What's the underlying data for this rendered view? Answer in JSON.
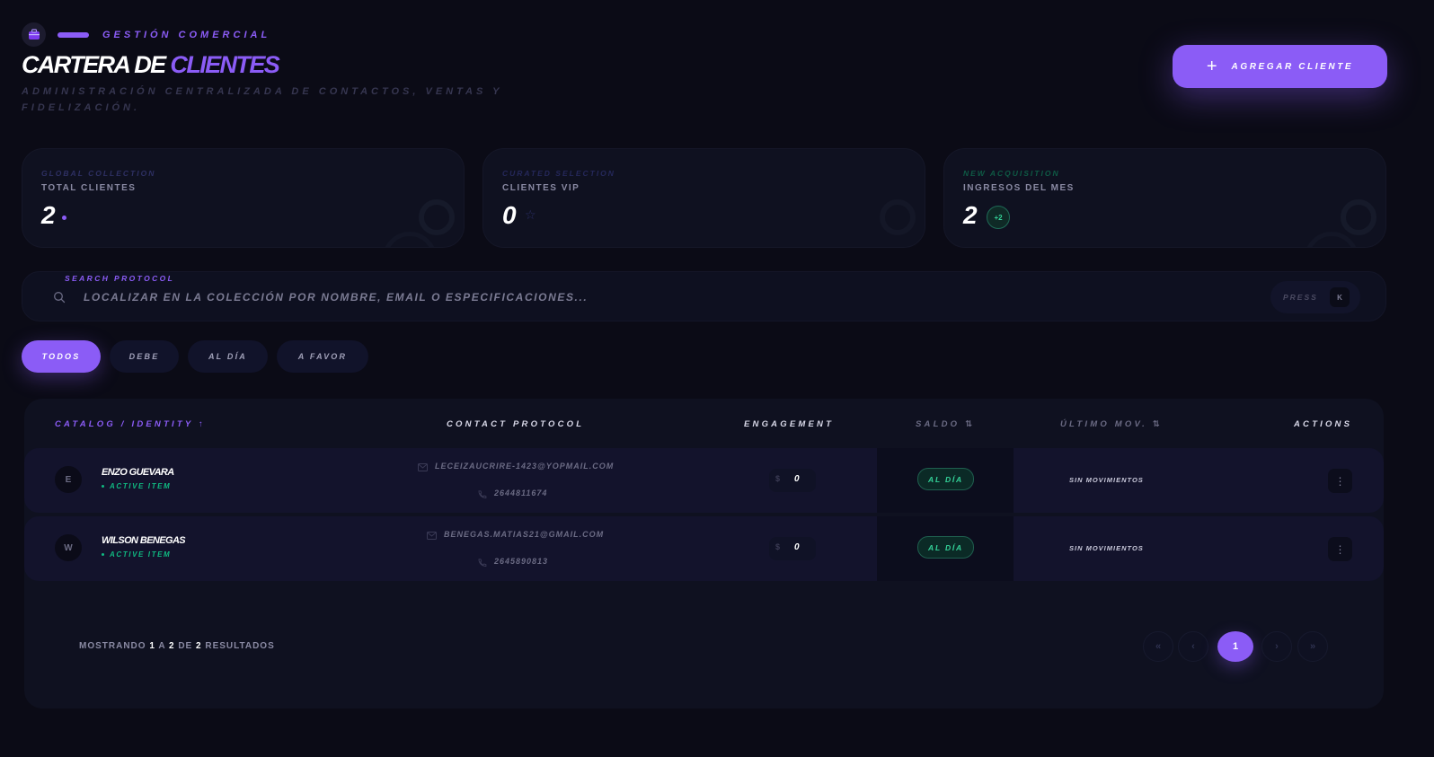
{
  "header": {
    "eyebrow": "GESTIÓN COMERCIAL",
    "title_main": "CARTERA DE",
    "title_accent": "CLIENTES",
    "subtitle": "ADMINISTRACIÓN CENTRALIZADA DE CONTACTOS, VENTAS Y FIDELIZACIÓN.",
    "add_button_label": "AGREGAR CLIENTE"
  },
  "stats": [
    {
      "kicker": "GLOBAL COLLECTION",
      "label": "TOTAL CLIENTES",
      "value": "2",
      "kicker_color": "#2e3063"
    },
    {
      "kicker": "CURATED SELECTION",
      "label": "CLIENTES VIP",
      "value": "0",
      "kicker_color": "#25285a"
    },
    {
      "kicker": "NEW ACQUISITION",
      "label": "INGRESOS DEL MES",
      "value": "2",
      "badge": "+2",
      "kicker_color": "#0f5a45"
    }
  ],
  "search": {
    "label": "SEARCH PROTOCOL",
    "placeholder": "LOCALIZAR EN LA COLECCIÓN POR NOMBRE, EMAIL O ESPECIFICACIONES...",
    "press_label": "PRESS",
    "shortcut_key": "K"
  },
  "filters": [
    {
      "label": "TODOS",
      "active": true
    },
    {
      "label": "DEBE",
      "active": false
    },
    {
      "label": "AL DÍA",
      "active": false
    },
    {
      "label": "A FAVOR",
      "active": false
    }
  ],
  "table": {
    "columns": [
      "CATALOG / IDENTITY ↑",
      "CONTACT PROTOCOL",
      "ENGAGEMENT",
      "SALDO ⇅",
      "ÚLTIMO MOV. ⇅",
      "ACTIONS"
    ],
    "rows": [
      {
        "initial": "E",
        "name": "ENZO GUEVARA",
        "status": "ACTIVE ITEM",
        "email": "LECEIZAUCRIRE-1423@YOPMAIL.COM",
        "phone": "2644811674",
        "engagement": "0",
        "saldo": "AL DÍA",
        "last_movement": "SIN MOVIMIENTOS"
      },
      {
        "initial": "W",
        "name": "WILSON BENEGAS",
        "status": "ACTIVE ITEM",
        "email": "BENEGAS.MATIAS21@GMAIL.COM",
        "phone": "2645890813",
        "engagement": "0",
        "saldo": "AL DÍA",
        "last_movement": "SIN MOVIMIENTOS"
      }
    ]
  },
  "footer": {
    "prefix": "MOSTRANDO",
    "from": "1",
    "sep1": "A",
    "to": "2",
    "sep2": "DE",
    "total": "2",
    "suffix": "RESULTADOS"
  },
  "pagination": {
    "first": "«",
    "prev": "‹",
    "current": "1",
    "next": "›",
    "last": "»"
  },
  "colors": {
    "accent": "#8b5cf6",
    "success": "#34d399",
    "background": "#0b0b16"
  }
}
